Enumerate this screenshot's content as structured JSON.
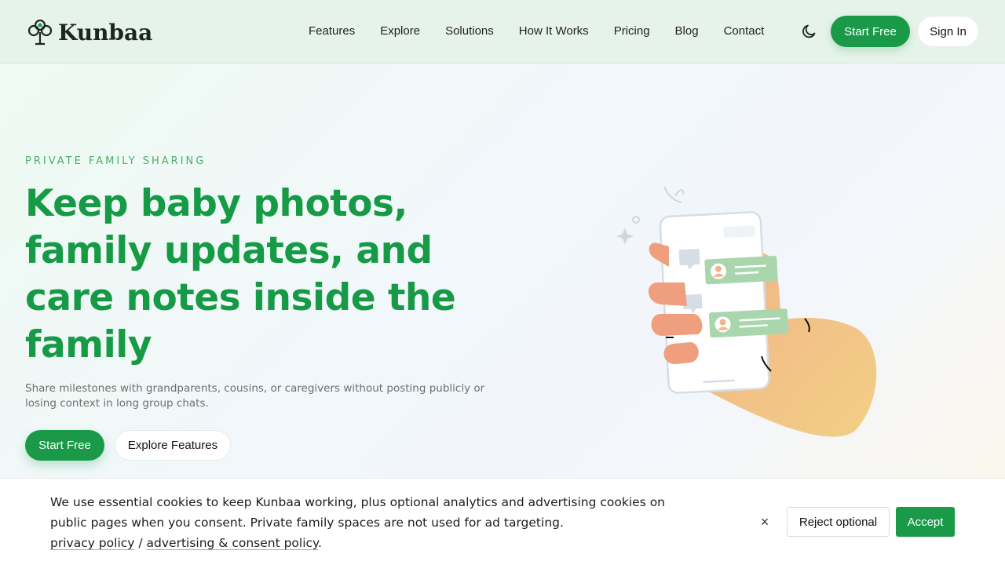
{
  "header": {
    "brand": "Kunbaa",
    "nav": [
      "Features",
      "Explore",
      "Solutions",
      "How It Works",
      "Pricing",
      "Blog",
      "Contact"
    ],
    "theme_icon": "moon-icon",
    "start_label": "Start Free",
    "signin_label": "Sign In"
  },
  "hero": {
    "eyebrow": "PRIVATE FAMILY SHARING",
    "headline": "Keep baby photos, family updates, and care notes inside the family",
    "subtext": "Share milestones with grandparents, cousins, or caregivers without posting publicly or losing context in long group chats.",
    "primary_label": "Start Free",
    "secondary_label": "Explore Features",
    "illustration_icon": "hand-holding-phone-chat-illustration"
  },
  "cookie": {
    "text": "We use essential cookies to keep Kunbaa working, plus optional analytics and advertising cookies on public pages when you consent. Private family spaces are not used for ad targeting.",
    "privacy_link": "privacy policy",
    "separator": " / ",
    "ad_link": "advertising & consent policy",
    "period": ".",
    "close": "×",
    "reject_label": "Reject optional",
    "accept_label": "Accept"
  },
  "colors": {
    "brand_green": "#1a9a48",
    "headline_green": "#169a46",
    "eyebrow_green": "#4aae6d",
    "header_bg": "#e6f3ea"
  }
}
